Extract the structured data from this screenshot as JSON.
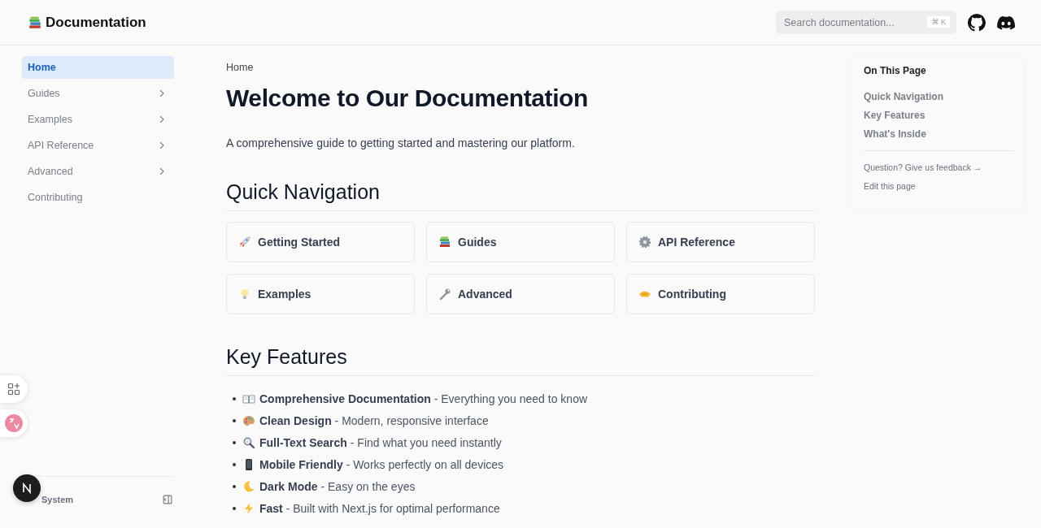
{
  "header": {
    "title": "Documentation",
    "search": {
      "placeholder": "Search documentation...",
      "shortcut": "⌘ K"
    }
  },
  "sidebar": {
    "items": [
      {
        "label": "Home",
        "selected": true,
        "expandable": false
      },
      {
        "label": "Guides",
        "selected": false,
        "expandable": true
      },
      {
        "label": "Examples",
        "selected": false,
        "expandable": true
      },
      {
        "label": "API Reference",
        "selected": false,
        "expandable": true
      },
      {
        "label": "Advanced",
        "selected": false,
        "expandable": true
      },
      {
        "label": "Contributing",
        "selected": false,
        "expandable": false
      }
    ],
    "theme": "System"
  },
  "breadcrumb": "Home",
  "title": "Welcome to Our Documentation",
  "intro": "A comprehensive guide to getting started and mastering our platform.",
  "sections": [
    {
      "heading": "Quick Navigation",
      "kind": "cards",
      "cards": [
        "Getting Started",
        "Guides",
        "API Reference",
        "Examples",
        "Advanced",
        "Contributing"
      ]
    },
    {
      "heading": "Key Features",
      "kind": "list",
      "items": [
        {
          "term": "Comprehensive Documentation",
          "text": " - Everything you need to know"
        },
        {
          "term": "Clean Design",
          "text": " - Modern, responsive interface"
        },
        {
          "term": "Full-Text Search",
          "text": " - Find what you need instantly"
        },
        {
          "term": "Mobile Friendly",
          "text": " - Works perfectly on all devices"
        },
        {
          "term": "Dark Mode",
          "text": " - Easy on the eyes"
        },
        {
          "term": "Fast",
          "text": " - Built with Next.js for optimal performance"
        }
      ]
    }
  ],
  "toc": {
    "title": "On This Page",
    "links": [
      "Quick Navigation",
      "Key Features",
      "What's Inside"
    ],
    "footer_links": [
      "Question? Give us feedback →",
      "Edit this page"
    ]
  }
}
